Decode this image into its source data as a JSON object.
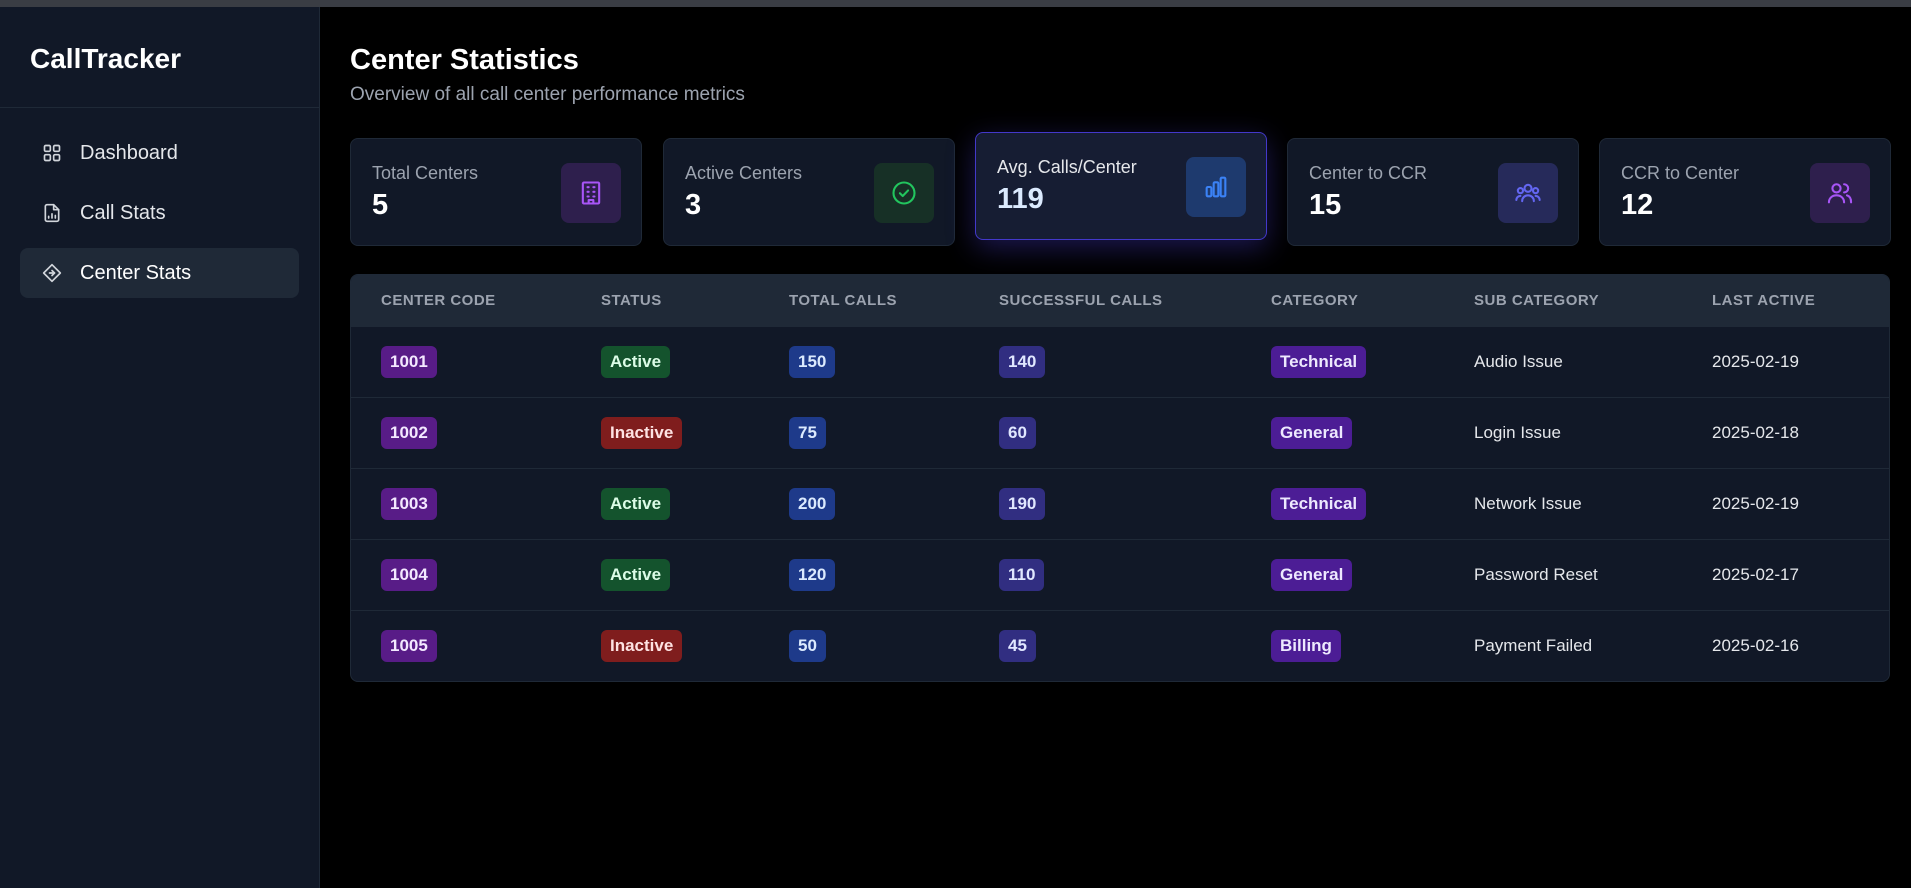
{
  "app": {
    "title": "CallTracker"
  },
  "sidebar": {
    "items": [
      {
        "label": "Dashboard",
        "icon": "grid-icon"
      },
      {
        "label": "Call Stats",
        "icon": "chart-file-icon"
      },
      {
        "label": "Center Stats",
        "icon": "diamond-icon",
        "active": true
      }
    ]
  },
  "page": {
    "title": "Center Statistics",
    "subtitle": "Overview of all call center performance metrics"
  },
  "cards": [
    {
      "label": "Total Centers",
      "value": "5",
      "icon": "building-icon",
      "icon_color": "#a855f7",
      "icon_bg": "#2e1f4d"
    },
    {
      "label": "Active Centers",
      "value": "3",
      "icon": "check-circle-icon",
      "icon_color": "#22c55e",
      "icon_bg": "#173026"
    },
    {
      "label": "Avg. Calls/Center",
      "value": "119",
      "icon": "bar-chart-icon",
      "icon_color": "#3b82f6",
      "icon_bg": "#1e3a6e"
    },
    {
      "label": "Center to CCR",
      "value": "15",
      "icon": "users-group-icon",
      "icon_color": "#6366f1",
      "icon_bg": "#262a5a"
    },
    {
      "label": "CCR to Center",
      "value": "12",
      "icon": "users-icon",
      "icon_color": "#a855f7",
      "icon_bg": "#2e1f4d"
    }
  ],
  "table": {
    "headers": [
      "Center Code",
      "Status",
      "Total Calls",
      "Successful Calls",
      "Category",
      "Sub Category",
      "Last Active"
    ],
    "rows": [
      {
        "code": "1001",
        "status": "Active",
        "total": "150",
        "success": "140",
        "category": "Technical",
        "sub": "Audio Issue",
        "last": "2025-02-19"
      },
      {
        "code": "1002",
        "status": "Inactive",
        "total": "75",
        "success": "60",
        "category": "General",
        "sub": "Login Issue",
        "last": "2025-02-18"
      },
      {
        "code": "1003",
        "status": "Active",
        "total": "200",
        "success": "190",
        "category": "Technical",
        "sub": "Network Issue",
        "last": "2025-02-19"
      },
      {
        "code": "1004",
        "status": "Active",
        "total": "120",
        "success": "110",
        "category": "General",
        "sub": "Password Reset",
        "last": "2025-02-17"
      },
      {
        "code": "1005",
        "status": "Inactive",
        "total": "50",
        "success": "45",
        "category": "Billing",
        "sub": "Payment Failed",
        "last": "2025-02-16"
      }
    ]
  },
  "colors": {
    "accent": "#4338ca",
    "status_active": "#14532d",
    "status_inactive": "#7f1d1d"
  }
}
